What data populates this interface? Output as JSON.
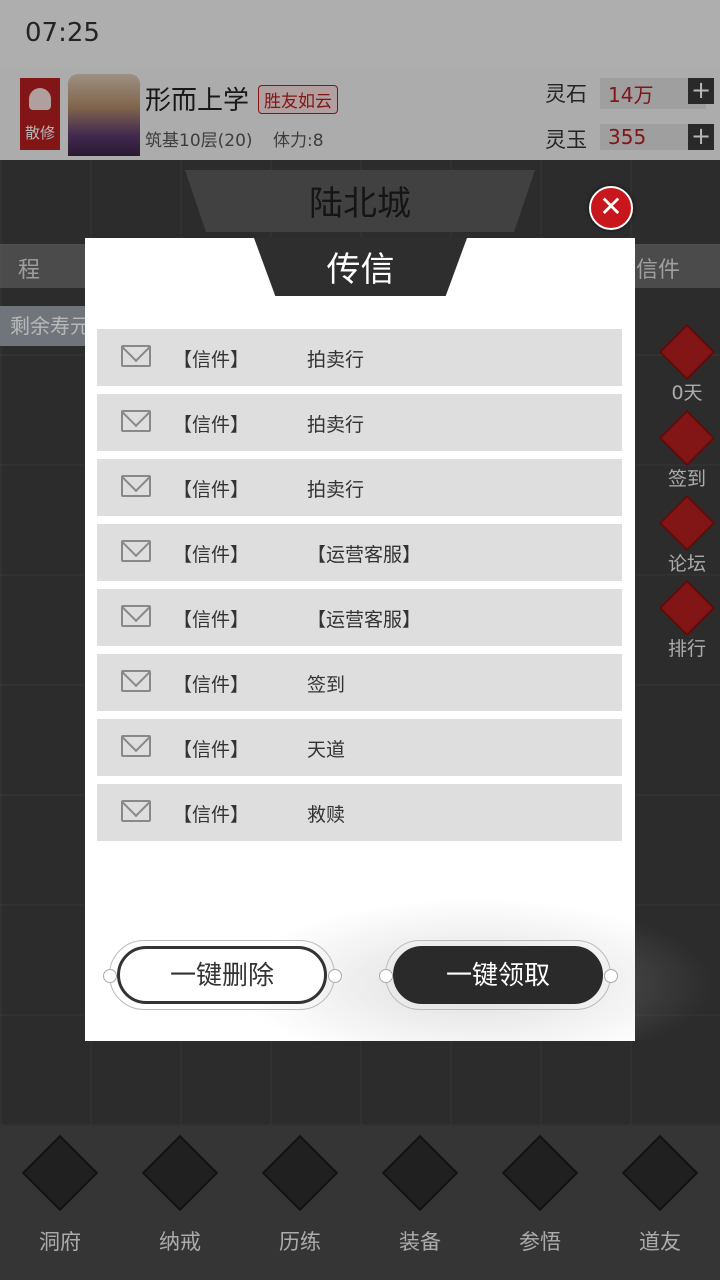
{
  "statusbar": {
    "time": "07:25"
  },
  "player": {
    "sect_badge": "散修",
    "name": "形而上学",
    "tag": "胜友如云",
    "realm": "筑基10层(20)",
    "stamina": "体力:8"
  },
  "resources": [
    {
      "label": "灵石",
      "value": "14万",
      "plus": "+"
    },
    {
      "label": "灵玉",
      "value": "355",
      "plus": "+"
    }
  ],
  "city": {
    "name": "陆北城",
    "close": "✕"
  },
  "strip": {
    "left": "程",
    "right": "信件"
  },
  "lifespan": "剩余寿元",
  "side_menu": [
    {
      "label": "0天",
      "icon": "token-icon"
    },
    {
      "label": "签到",
      "icon": "calendar-icon"
    },
    {
      "label": "论坛",
      "icon": "forum-icon"
    },
    {
      "label": "排行",
      "icon": "ranking-icon"
    }
  ],
  "modal": {
    "title": "传信",
    "mails": [
      {
        "type": "【信件】",
        "sender": "拍卖行"
      },
      {
        "type": "【信件】",
        "sender": "拍卖行"
      },
      {
        "type": "【信件】",
        "sender": "拍卖行"
      },
      {
        "type": "【信件】",
        "sender": "【运营客服】"
      },
      {
        "type": "【信件】",
        "sender": "【运营客服】"
      },
      {
        "type": "【信件】",
        "sender": "签到"
      },
      {
        "type": "【信件】",
        "sender": "天道"
      },
      {
        "type": "【信件】",
        "sender": "救赎"
      }
    ],
    "delete_all": "一键删除",
    "claim_all": "一键领取"
  },
  "bottom_nav": [
    {
      "label": "洞府",
      "icon": "cave-gate-icon"
    },
    {
      "label": "纳戒",
      "icon": "ring-icon"
    },
    {
      "label": "历练",
      "icon": "crossed-swords-icon"
    },
    {
      "label": "装备",
      "icon": "sword-icon"
    },
    {
      "label": "参悟",
      "icon": "book-icon"
    },
    {
      "label": "道友",
      "icon": "handshake-icon"
    }
  ]
}
